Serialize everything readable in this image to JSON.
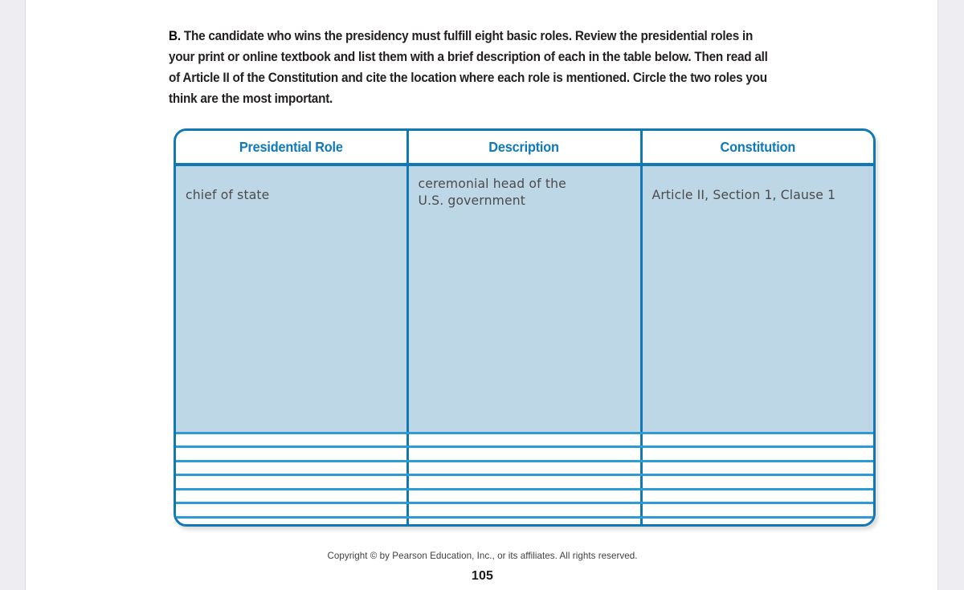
{
  "page": {
    "exercise_marker": "B.",
    "prompt": "The candidate who wins the presidency must fulfill eight basic roles. Review the presidential roles in your print or online textbook and list them with a brief description of each in the table below. Then read all of Article II of the Constitution and cite the location where each role is mentioned. Circle the two roles you think are the most important.",
    "copyright": "Copyright © by Pearson Education, Inc., or its affiliates.  All rights reserved.",
    "page_number": "105"
  },
  "table": {
    "headers": [
      "Presidential Role",
      "Description",
      "Constitution"
    ],
    "rows": [
      {
        "filled": true,
        "role": "chief of state",
        "description_line1": "ceremonial head of the",
        "description_line2": "U.S. government",
        "constitution": "Article II, Section 1, Clause 1"
      },
      {
        "filled": false,
        "role": "",
        "description_line1": "",
        "description_line2": "",
        "constitution": ""
      },
      {
        "filled": false,
        "role": "",
        "description_line1": "",
        "description_line2": "",
        "constitution": ""
      },
      {
        "filled": false,
        "role": "",
        "description_line1": "",
        "description_line2": "",
        "constitution": ""
      },
      {
        "filled": false,
        "role": "",
        "description_line1": "",
        "description_line2": "",
        "constitution": ""
      },
      {
        "filled": false,
        "role": "",
        "description_line1": "",
        "description_line2": "",
        "constitution": ""
      },
      {
        "filled": false,
        "role": "",
        "description_line1": "",
        "description_line2": "",
        "constitution": ""
      },
      {
        "filled": false,
        "role": "",
        "description_line1": "",
        "description_line2": "",
        "constitution": ""
      }
    ]
  },
  "colors": {
    "table_border": "#1278b4",
    "grid_line": "#2e9bd4",
    "header_text": "#0f79bd",
    "filled_row_bg": "#bed7e6",
    "handwriting_text": "#4c4a4b",
    "page_bg": "#ffffff",
    "gutter_bg": "#eeeef2"
  }
}
